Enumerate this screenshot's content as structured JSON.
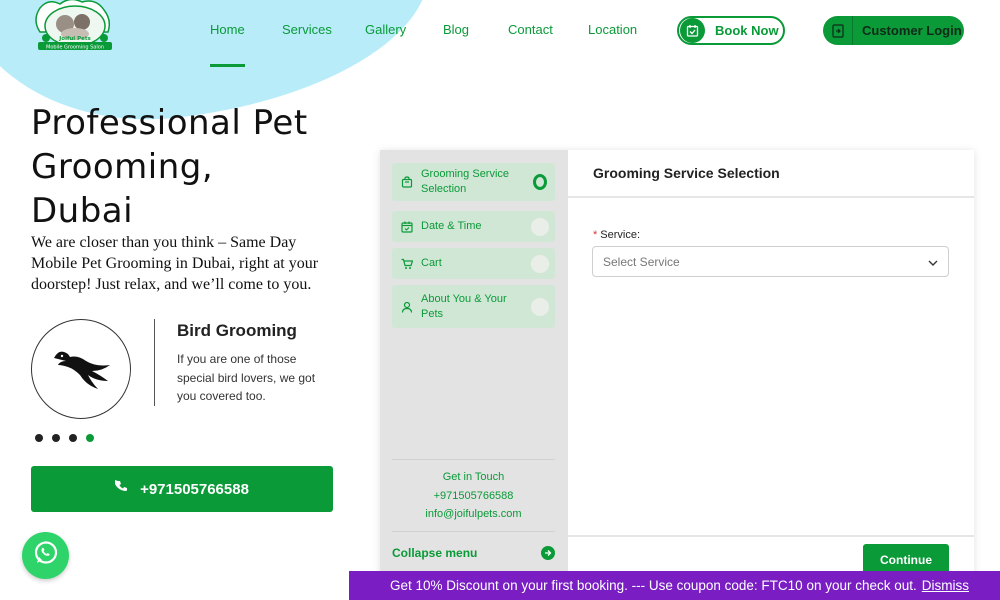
{
  "brand": {
    "logo_text": "Joiful Pets",
    "logo_tagline": "Mobile Grooming Salon"
  },
  "nav": {
    "items": [
      {
        "label": "Home",
        "active": true
      },
      {
        "label": "Services",
        "active": false
      },
      {
        "label": "Gallery",
        "active": false
      },
      {
        "label": "Blog",
        "active": false
      },
      {
        "label": "Contact",
        "active": false
      },
      {
        "label": "Location",
        "active": false
      }
    ],
    "book_now": "Book Now",
    "customer_login": "Customer Login"
  },
  "hero": {
    "title_line1": "Professional Pet",
    "title_line2": "Grooming,",
    "title_line3": "Dubai",
    "subtitle": "We are closer than you think – Same Day Mobile Pet Grooming in Dubai, right at your doorstep! Just relax, and we’ll come to you."
  },
  "feature": {
    "title": "Bird Grooming",
    "description": "If you are one of those special bird lovers, we got you covered too.",
    "icon": "bird-icon",
    "carousel_active_index": 3,
    "carousel_count": 4
  },
  "phone_button": {
    "label": "+971505766588",
    "icon": "phone-icon"
  },
  "booking_widget": {
    "steps": [
      {
        "label": "Grooming Service Selection",
        "icon": "cart-bag-icon",
        "active": true
      },
      {
        "label": "Date & Time",
        "icon": "calendar-icon",
        "active": false
      },
      {
        "label": "Cart",
        "icon": "cart-icon",
        "active": false
      },
      {
        "label": "About You & Your Pets",
        "icon": "user-icon",
        "active": false
      }
    ],
    "contact": {
      "heading": "Get in Touch",
      "phone": "+971505766588",
      "email": "info@joifulpets.com"
    },
    "collapse_label": "Collapse menu",
    "main_title": "Grooming Service Selection",
    "field_label": "Service:",
    "field_required": "*",
    "select_placeholder": "Select Service",
    "continue_label": "Continue"
  },
  "promo": {
    "text": "Get 10% Discount on your first booking. --- Use coupon code: FTC10 on your check out.",
    "dismiss": "Dismiss"
  },
  "colors": {
    "brand_green": "#0a9a38",
    "promo_purple": "#7a1ec4",
    "blob_blue": "#b8ecf9",
    "whatsapp_green": "#2ed36a"
  }
}
